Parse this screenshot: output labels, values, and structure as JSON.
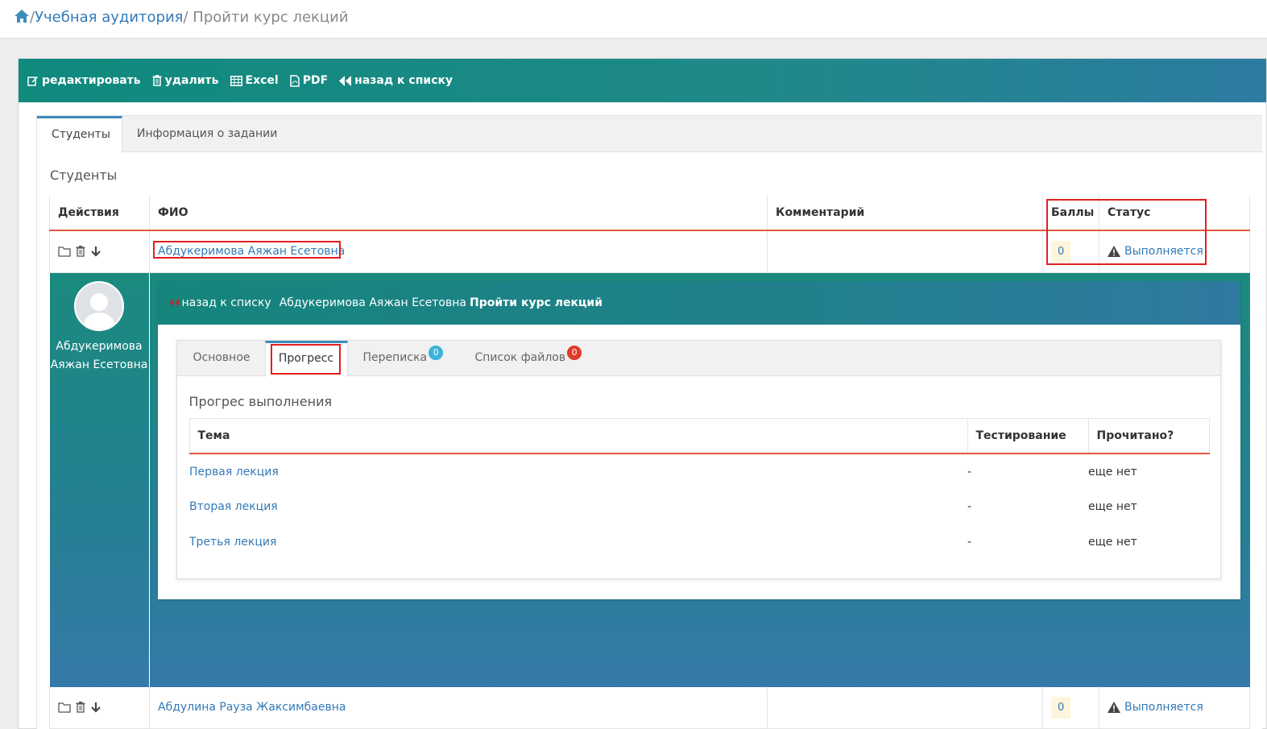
{
  "breadcrumb": {
    "home_icon": "home-icon",
    "items": [
      "Учебная аудитория",
      "Пройти курс лекций"
    ],
    "separator": "/"
  },
  "toolbar": {
    "edit": "редактировать",
    "delete": "удалить",
    "excel": "Excel",
    "pdf": "PDF",
    "back": "назад к списку"
  },
  "tabs": [
    "Студенты",
    "Информация о задании"
  ],
  "section_title": "Студенты",
  "table": {
    "headers": [
      "Действия",
      "ФИО",
      "Комментарий",
      "Баллы",
      "Статус"
    ],
    "rows": [
      {
        "name": "Абдукеримова Аяжан Есетовна",
        "comment": "",
        "score": "0",
        "status": "Выполняется"
      },
      {
        "name": "Абдулина Рауза Жаксимбаевна",
        "comment": "",
        "score": "0",
        "status": "Выполняется"
      }
    ]
  },
  "detail": {
    "student_name": "Абдукеримова Аяжан Есетовна",
    "header": {
      "back": "назад к списку",
      "student": "Абдукеримова Аяжан Есетовна",
      "task": "Пройти курс лекций"
    },
    "tabs": [
      {
        "label": "Основное"
      },
      {
        "label": "Прогресс"
      },
      {
        "label": "Переписка",
        "badge": "0"
      },
      {
        "label": "Список файлов",
        "badge": "0"
      }
    ],
    "progress_title": "Прогрес выполнения",
    "progress_headers": [
      "Тема",
      "Тестирование",
      "Прочитано?"
    ],
    "progress_rows": [
      {
        "topic": "Первая лекция",
        "test": "-",
        "read": "еще нет"
      },
      {
        "topic": "Вторая лекция",
        "test": "-",
        "read": "еще нет"
      },
      {
        "topic": "Третья лекция",
        "test": "-",
        "read": "еще нет"
      }
    ]
  },
  "colors": {
    "accent": "#1a8a7e",
    "link": "#337ab7",
    "highlight": "#e31e1e",
    "header_rule": "#e05a3e"
  }
}
